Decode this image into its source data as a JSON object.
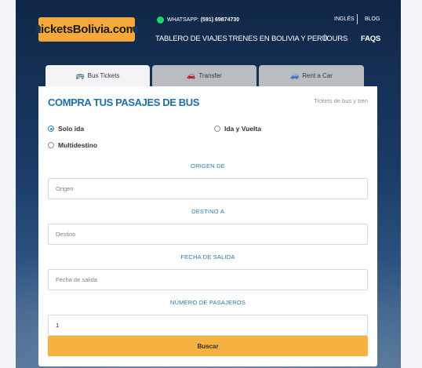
{
  "header": {
    "logo_text": "ticketsBolivia.com",
    "whatsapp_prefix": "WHATSAPP:",
    "whatsapp_number": "(591) 69874730",
    "lang": "INGLÉS",
    "blog": "BLOG",
    "nav": [
      "TABLERO DE VIAJES",
      "TRENES EN BOLIVIA Y PERÚ",
      "TOURS",
      "FAQS"
    ]
  },
  "tabs": [
    {
      "label": "Bus Tickets",
      "icon": "bus-icon",
      "glyph": "🚌"
    },
    {
      "label": "Transfer",
      "icon": "car-icon",
      "glyph": "🚗"
    },
    {
      "label": "Rent a Car",
      "icon": "rent-car-icon",
      "glyph": "🚙"
    }
  ],
  "form": {
    "title": "COMPRA TUS PASAJES DE BUS",
    "subtitle": "Tickets de bus y tren",
    "trip_types": [
      "Solo ida",
      "Ida y Vuelta",
      "Multidestino"
    ],
    "selected_trip_type": "Solo ida",
    "origin_label": "ORIGEN DE",
    "origin_placeholder": "Origen",
    "destination_label": "DESTINO A",
    "destination_placeholder": "Destino",
    "date_label": "FECHA DE SALIDA",
    "date_placeholder": "Fecha de salida",
    "passengers_label": "NÚMERO DE PASAJEROS",
    "passengers_value": "1",
    "submit_label": "Buscar"
  },
  "colors": {
    "accent": "#f6b240",
    "title_blue": "#1f6fa8",
    "hero_dark": "#0f2746"
  }
}
